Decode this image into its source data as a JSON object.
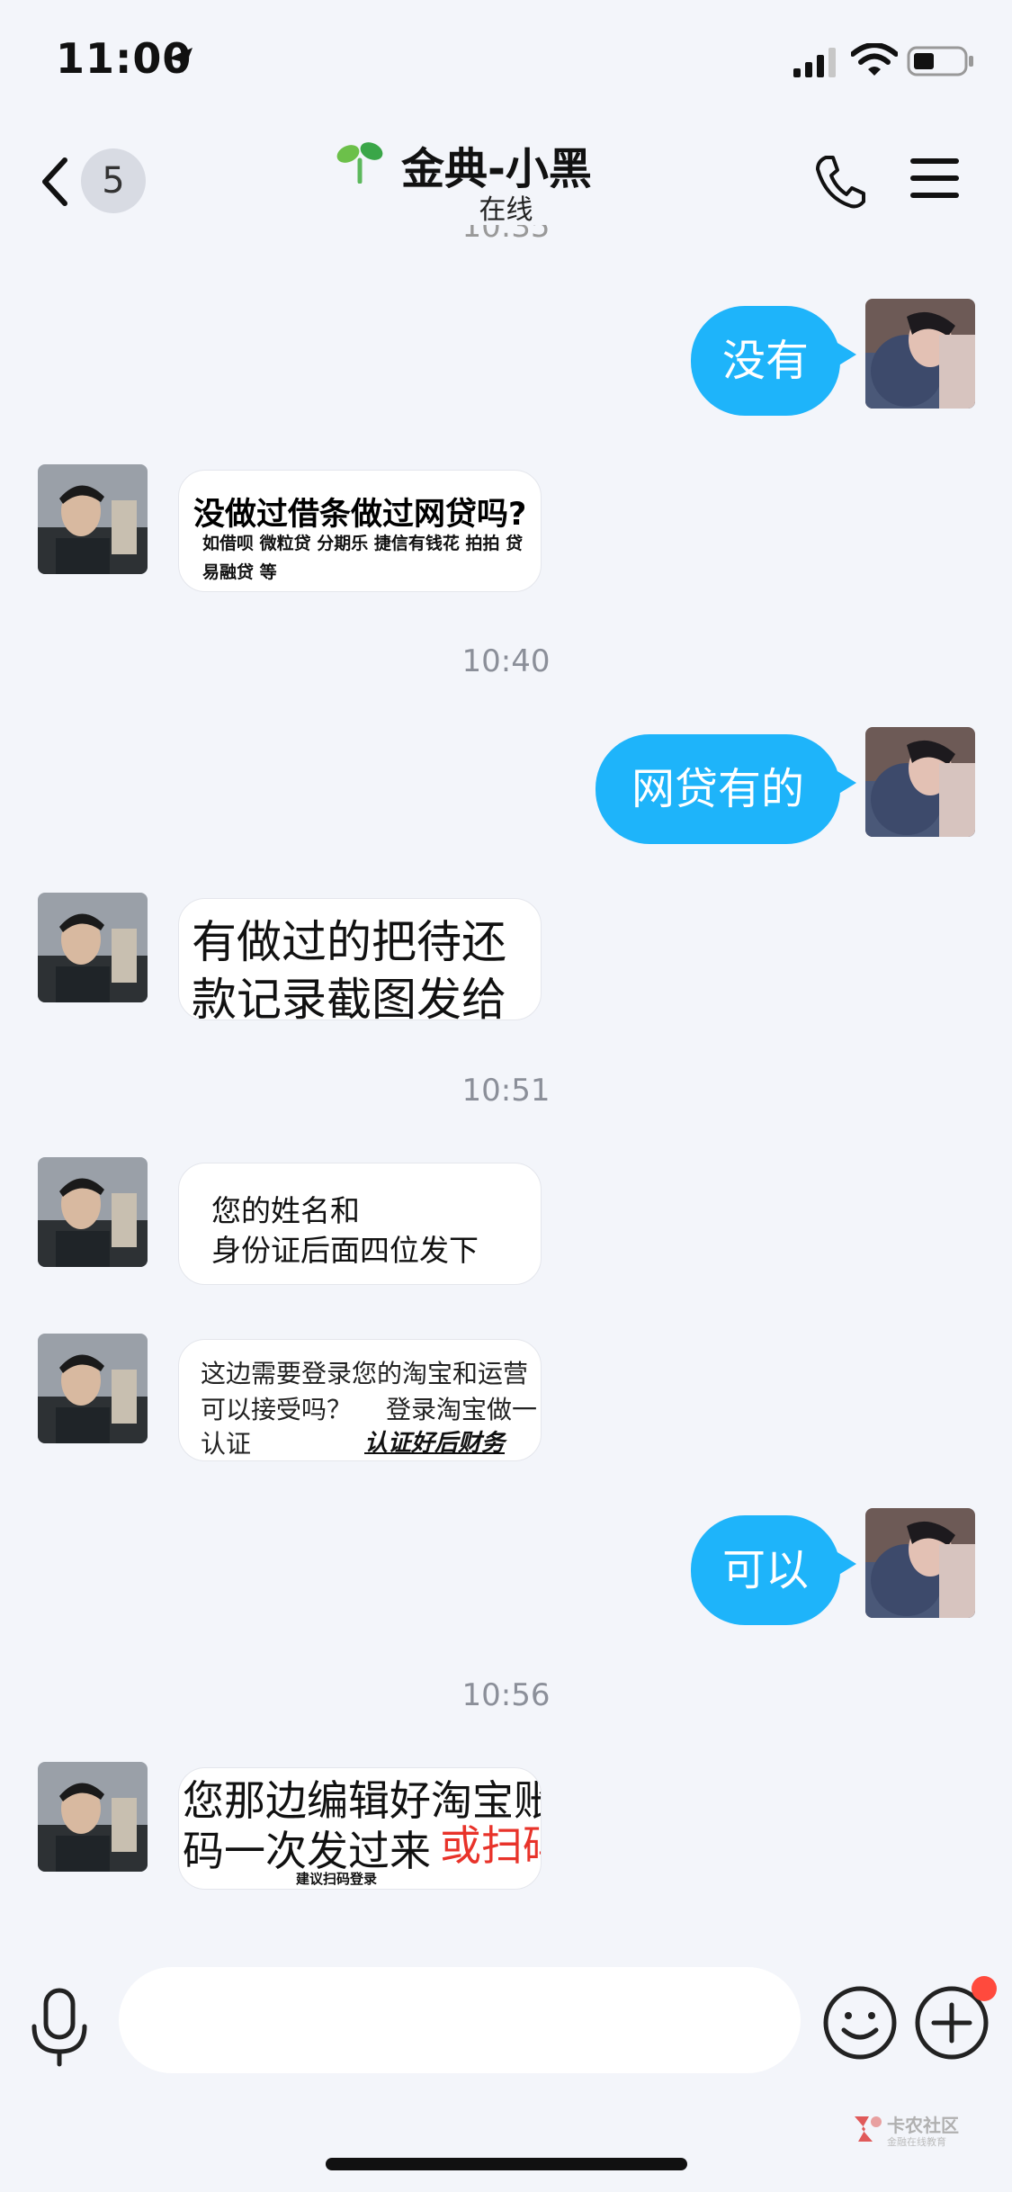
{
  "status_bar": {
    "time": "11:00"
  },
  "nav": {
    "back_badge": "5",
    "title": "金典-小黑",
    "subtitle": "在线"
  },
  "messages": {
    "peek_time": "10:35",
    "out_1": "没有",
    "in_1": {
      "headline": "没做过借条做过网贷吗?",
      "line2": "如借呗  微粒贷 分期乐  捷信有钱花 拍拍 贷",
      "line3": "易融贷  等"
    },
    "time_1": "10:40",
    "out_2": "网贷有的",
    "in_2": {
      "line1": "有做过的把待还",
      "line2": "款记录截图发给"
    },
    "time_2": "10:51",
    "in_3": {
      "line1": "您的姓名和",
      "line2": "身份证后面四位发下"
    },
    "in_4": {
      "line1": "这边需要登录您的淘宝和运营",
      "line2a": "可以接受吗？",
      "line2b": "登录淘宝做一",
      "line3a": "认证",
      "line3b": "认证好后财务"
    },
    "out_3": "可以",
    "time_3": "10:56",
    "in_5": {
      "line1": "您那边编辑好淘宝账",
      "line2a": "码一次发过来",
      "line2b": "或扫码",
      "line3": "建议扫码登录"
    }
  },
  "watermark": {
    "title": "卡农社区",
    "subtitle": "金融在线教育"
  },
  "colors": {
    "outgoing_bubble": "#1eb4fa",
    "background": "#f3f5fa",
    "notification_dot": "#ff4a3d",
    "highlight_text": "#e8332a"
  }
}
